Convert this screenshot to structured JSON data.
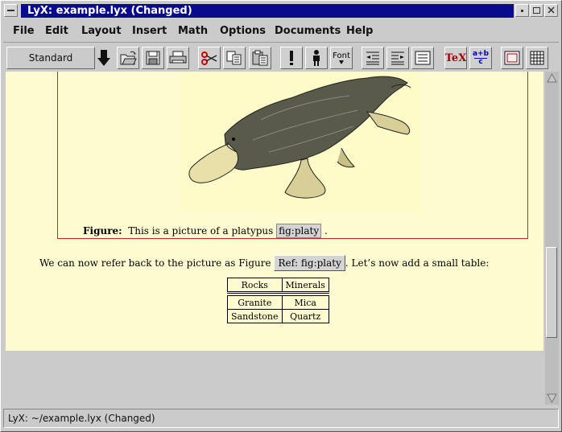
{
  "window": {
    "title": "LyX: example.lyx (Changed)"
  },
  "menu": [
    "File",
    "Edit",
    "Layout",
    "Insert",
    "Math",
    "Options",
    "Documents",
    "Help"
  ],
  "toolbar": {
    "style_value": "Standard",
    "font_label": "Font",
    "tex_label": "TeX",
    "math_label_top": "a+b",
    "math_label_bottom": "c"
  },
  "document": {
    "figure_caption_label": "Figure:",
    "figure_caption_text": "This is a picture of a platypus",
    "figure_label": "fig:platy",
    "paragraph_before": "We can now refer back to the picture as Figure",
    "ref_label": "Ref: fig:platy",
    "paragraph_after": ". Let’s now add a small table:",
    "table": {
      "header": [
        "Rocks",
        "Minerals"
      ],
      "rows": [
        [
          "Granite",
          "Mica"
        ],
        [
          "Sandstone",
          "Quartz"
        ]
      ]
    }
  },
  "status": "LyX: ~/example.lyx (Changed)"
}
